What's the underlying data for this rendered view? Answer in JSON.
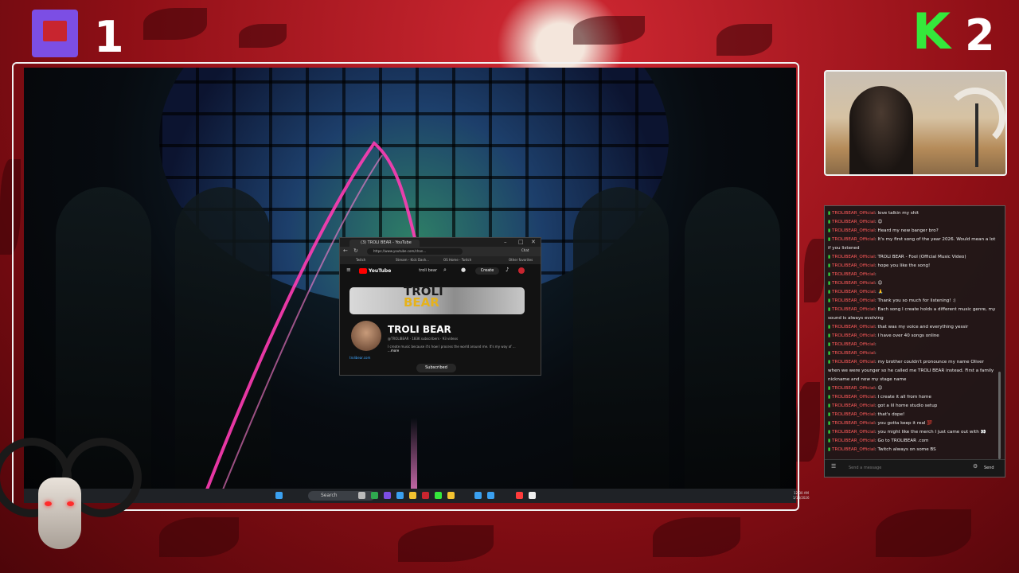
{
  "overlay": {
    "player_one": "1",
    "player_two": "2",
    "twitch_logo": "twitch-icon",
    "kick_logo": "kick-icon",
    "kick_letter": "K"
  },
  "taskbar": {
    "search_label": "Search",
    "clock_time": "12:30 AM",
    "clock_date": "1/14/2026"
  },
  "browser": {
    "tab_title": "(3) TROLI BEAR - YouTube",
    "url": "https://www.youtube.com/chan...",
    "bookmarks": [
      "Twitch",
      "Stream - Kick Dash...",
      "OS Home - Twitch",
      "Other favorites"
    ],
    "chat_pill": "Chat",
    "youtube_label": "YouTube",
    "search_query": "troli bear",
    "create_label": "Create",
    "banner_line1": "TROLI",
    "banner_line2": "BEAR",
    "channel_name": "TROLI BEAR",
    "channel_meta": "@TROLIBEAR · 183K subscribers · 93 videos",
    "channel_desc": "I create music because it's how I process the world around me. It's my way of ...",
    "more_label": "...more",
    "channel_link": "trolibear.com",
    "subscribed_label": "Subscribed"
  },
  "chat": {
    "messages": [
      {
        "user": "TROLIBEAR_Official",
        "text": "love talkin my shit"
      },
      {
        "user": "TROLIBEAR_Official",
        "text": "😊"
      },
      {
        "user": "TROLIBEAR_Official",
        "text": "Heard my new banger bro?"
      },
      {
        "user": "TROLIBEAR_Official",
        "text": "It's my first song of the year 2026. Would mean a lot if you listened"
      },
      {
        "user": "TROLIBEAR_Official",
        "text": "TROLI BEAR - Fool (Official Music Video)"
      },
      {
        "user": "TROLIBEAR_Official",
        "text": "hope you like the song!"
      },
      {
        "user": "TROLIBEAR_Official",
        "text": ""
      },
      {
        "user": "TROLIBEAR_Official",
        "text": "😊"
      },
      {
        "user": "TROLIBEAR_Official",
        "text": "🙏"
      },
      {
        "user": "TROLIBEAR_Official",
        "text": "Thank you so much for listening! :)"
      },
      {
        "user": "TROLIBEAR_Official",
        "text": "Each song I create holds a different music genre, my sound is always evolving"
      },
      {
        "user": "TROLIBEAR_Official",
        "text": "that was my voice and everything yessir"
      },
      {
        "user": "TROLIBEAR_Official",
        "text": "I have over 40 songs online"
      },
      {
        "user": "TROLIBEAR_Official",
        "text": ""
      },
      {
        "user": "TROLIBEAR_Official",
        "text": ""
      },
      {
        "user": "TROLIBEAR_Official",
        "text": "my brother couldn't pronounce my name Oliver when we were younger so he called me TROLI BEAR instead. First a family nickname and now my stage name"
      },
      {
        "user": "TROLIBEAR_Official",
        "text": "😊"
      },
      {
        "user": "TROLIBEAR_Official",
        "text": "I create it all from home"
      },
      {
        "user": "TROLIBEAR_Official",
        "text": "got a lil home studio setup"
      },
      {
        "user": "TROLIBEAR_Official",
        "text": "that's dope!"
      },
      {
        "user": "TROLIBEAR_Official",
        "text": "you gotta keep it real 💯"
      },
      {
        "user": "TROLIBEAR_Official",
        "text": "you might like the merch I just came out with 👀"
      },
      {
        "user": "TROLIBEAR_Official",
        "text": "Go to TROLIBEAR .com"
      },
      {
        "user": "TROLIBEAR_Official",
        "text": "Twitch always on some BS"
      }
    ],
    "input_placeholder": "Send a message",
    "send_label": "Send"
  },
  "colors": {
    "accent_red": "#c8252f",
    "twitch_purple": "#7c4ee4",
    "kick_green": "#35e83b",
    "youtube_red": "#ff0000"
  }
}
